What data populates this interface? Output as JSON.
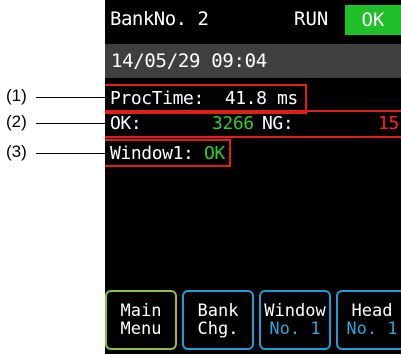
{
  "header": {
    "bank": "BankNo. 2",
    "run": "RUN",
    "ok": "OK",
    "datetime": "14/05/29 09:04"
  },
  "info": {
    "proctime_label": "ProcTime:",
    "proctime_value": "41.8 ms",
    "ok_label": "OK:",
    "ok_count": "3266",
    "ng_label": "NG:",
    "ng_count": "15",
    "window_label": "Window1:",
    "window_status": "OK"
  },
  "buttons": [
    {
      "l1": "Main",
      "l2": "Menu"
    },
    {
      "l1": "Bank",
      "l2": "Chg."
    },
    {
      "l1": "Window",
      "l2": "No. 1"
    },
    {
      "l1": "Head",
      "l2": "No. 1"
    }
  ],
  "callouts": [
    "(1)",
    "(2)",
    "(3)"
  ],
  "colors": {
    "ok_green": "#1fbf2a",
    "ng_red": "#ff2020",
    "highlight_red": "#e21c1c",
    "button_blue": "#1f9bd6",
    "button_main_green": "#8ac23a"
  }
}
